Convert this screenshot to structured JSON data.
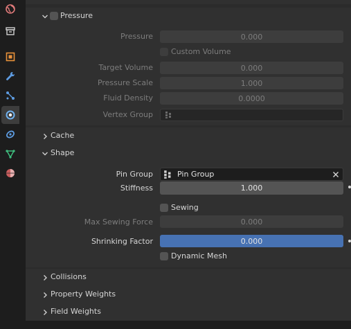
{
  "tabs": [
    {
      "icon": "world-icon",
      "active": false
    },
    {
      "icon": "collection-icon",
      "active": false
    },
    {
      "icon": "object-icon",
      "active": false
    },
    {
      "icon": "modifier-wrench-icon",
      "active": false
    },
    {
      "icon": "particles-icon",
      "active": false
    },
    {
      "icon": "physics-icon",
      "active": true
    },
    {
      "icon": "constraints-icon",
      "active": false
    },
    {
      "icon": "object-data-icon",
      "active": false
    },
    {
      "icon": "material-icon",
      "active": false
    }
  ],
  "pressure": {
    "header": "Pressure",
    "pressure_label": "Pressure",
    "pressure_value": "0.000",
    "custom_volume_label": "Custom Volume",
    "target_volume_label": "Target Volume",
    "target_volume_value": "0.000",
    "pressure_scale_label": "Pressure Scale",
    "pressure_scale_value": "1.000",
    "fluid_density_label": "Fluid Density",
    "fluid_density_value": "0.0000",
    "vertex_group_label": "Vertex Group"
  },
  "cache": {
    "header": "Cache"
  },
  "shape": {
    "header": "Shape",
    "pin_group_label": "Pin Group",
    "pin_group_value": "Pin Group",
    "stiffness_label": "Stiffness",
    "stiffness_value": "1.000",
    "sewing_label": "Sewing",
    "max_sewing_label": "Max Sewing Force",
    "max_sewing_value": "0.000",
    "shrinking_label": "Shrinking Factor",
    "shrinking_value": "0.000",
    "dynamic_mesh_label": "Dynamic Mesh"
  },
  "collisions": {
    "header": "Collisions"
  },
  "property_weights": {
    "header": "Property Weights"
  },
  "field_weights": {
    "header": "Field Weights"
  },
  "colors": {
    "accent": "#4772b3",
    "panel": "#2b2b2b",
    "field": "#545454"
  }
}
